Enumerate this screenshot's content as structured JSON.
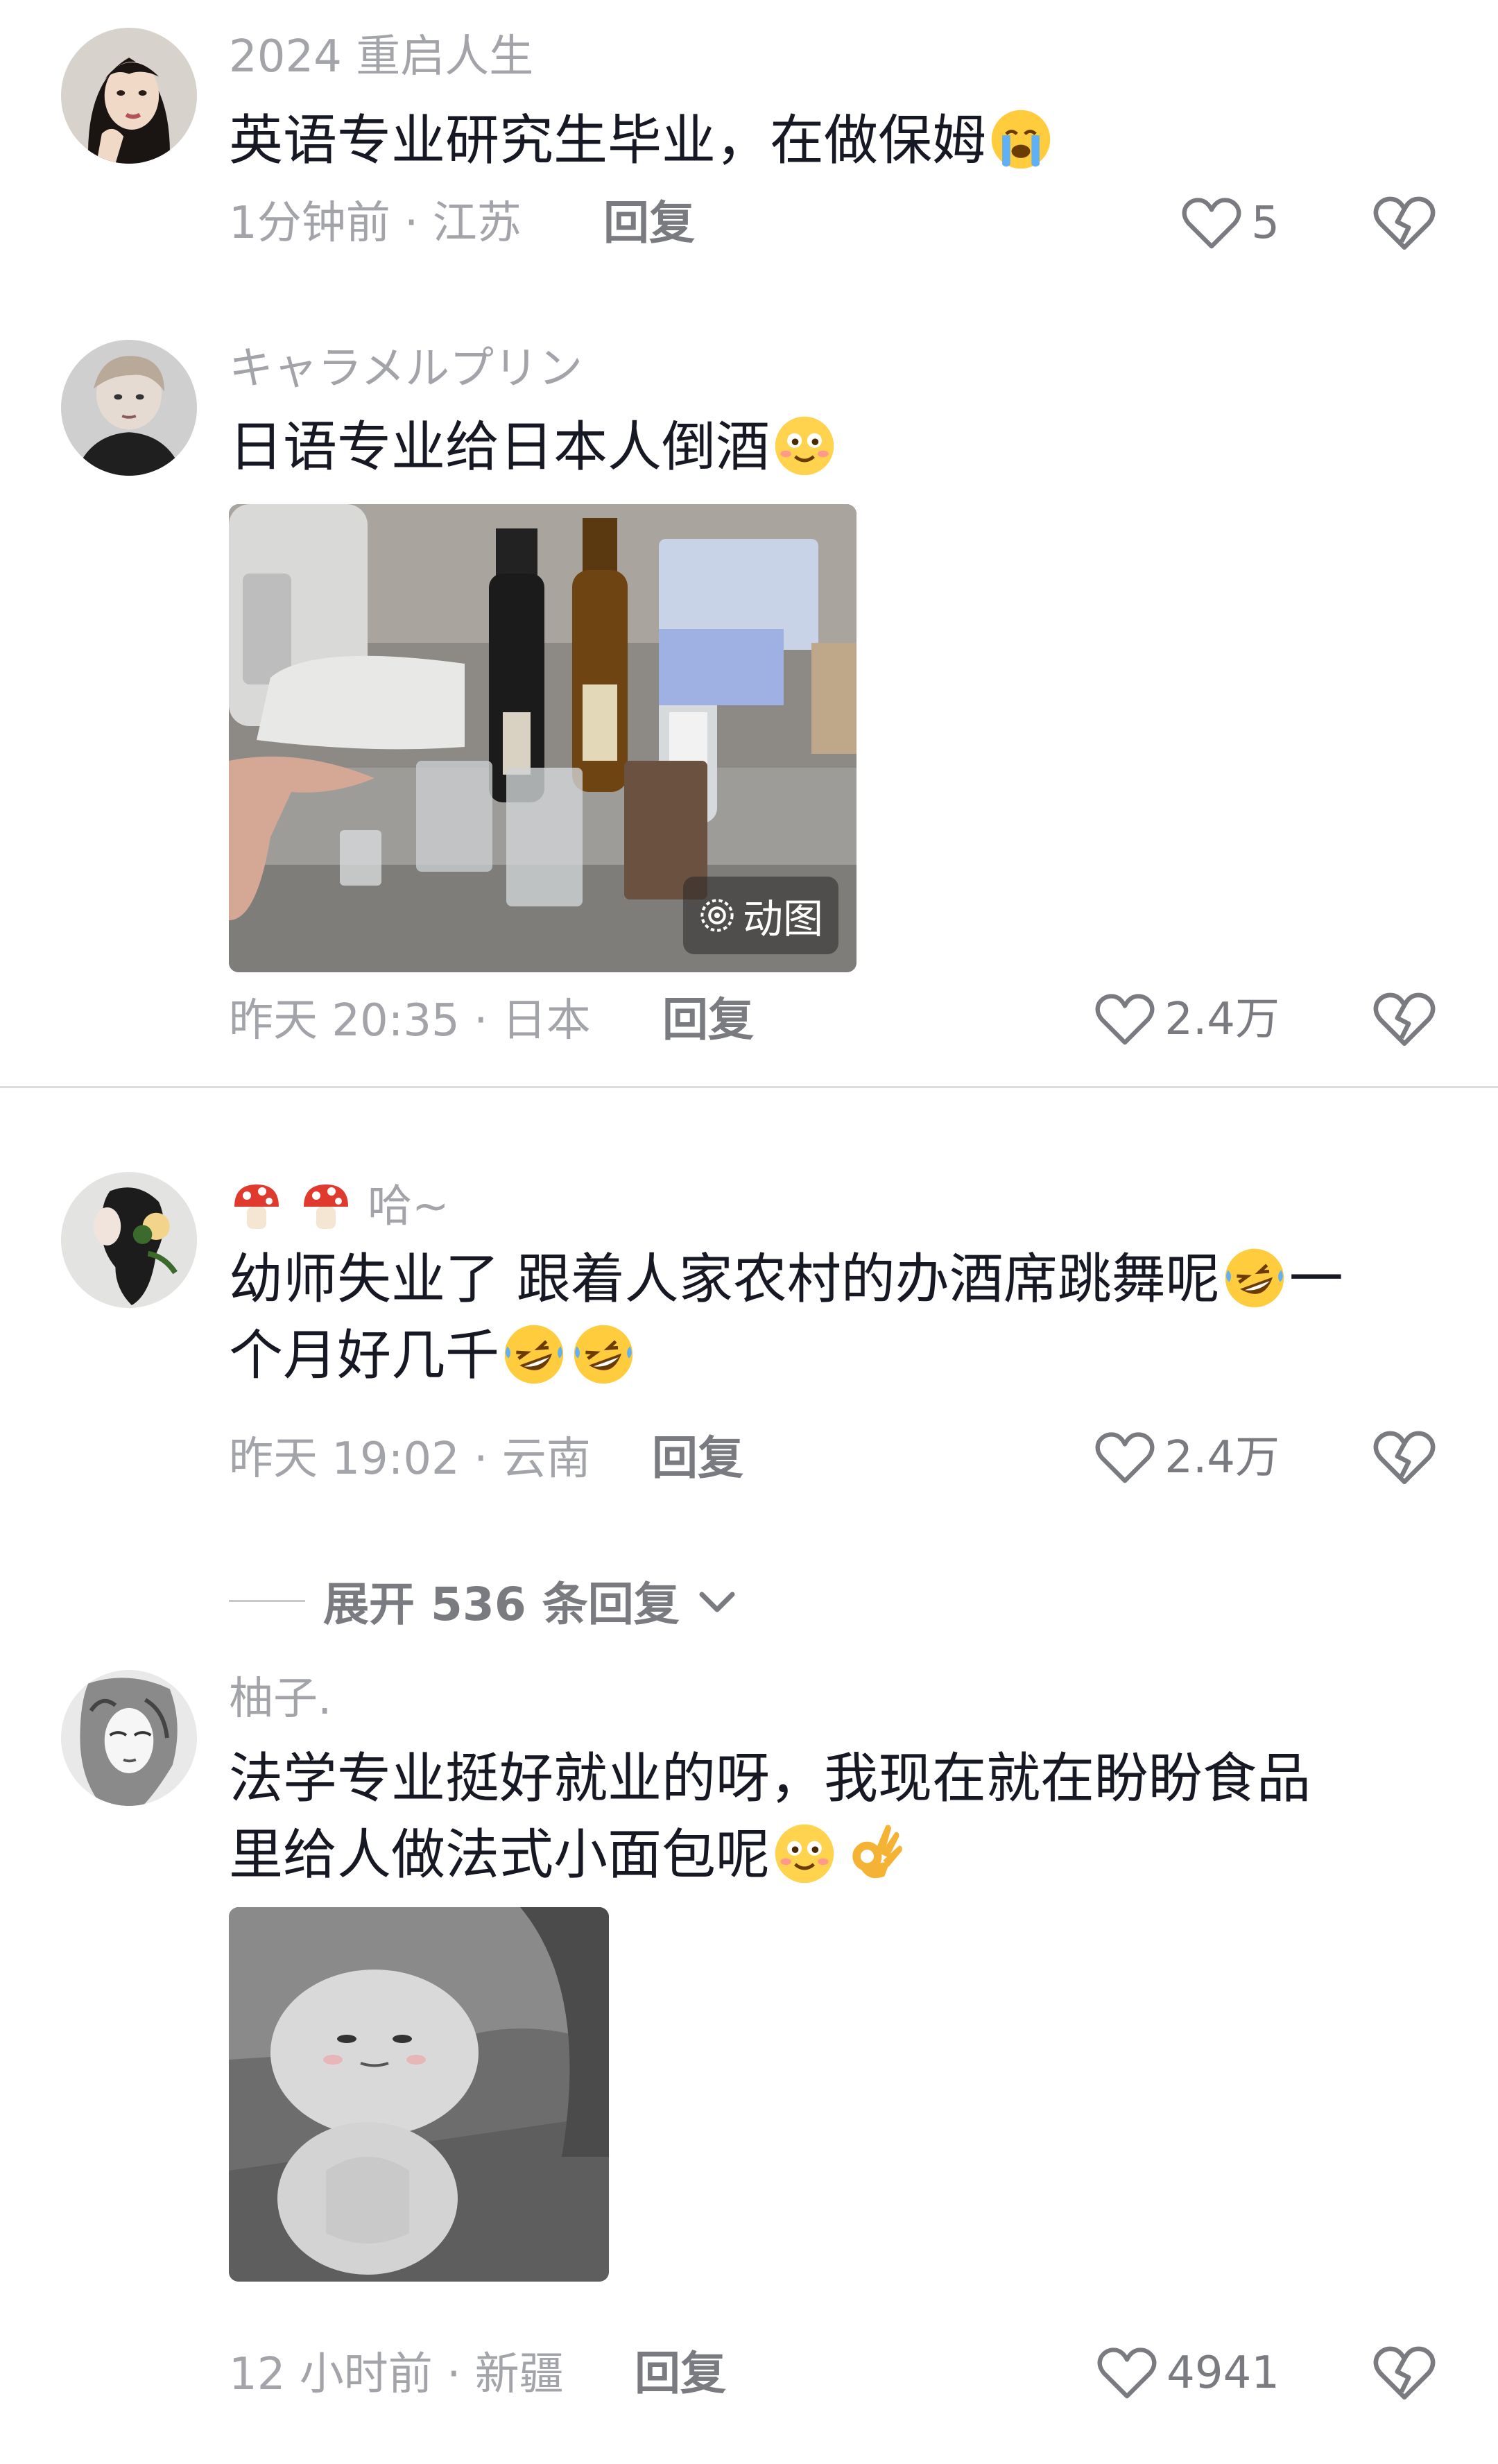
{
  "comments": [
    {
      "username": "2024 重启人生",
      "text": "英语专业研究生毕业，在做保姆",
      "emojis": [
        "crying-face"
      ],
      "time_location": "1分钟前 · 江苏",
      "reply_label": "回复",
      "likes": "5"
    },
    {
      "username": "キャラメルプリン",
      "text": "日语专业给日本人倒酒",
      "emojis": [
        "smiling-face"
      ],
      "media_badge": "动图",
      "time_location": "昨天 20:35 · 日本",
      "reply_label": "回复",
      "likes": "2.4万"
    },
    {
      "username": "哈~",
      "username_prefix_icons": [
        "mushroom",
        "mushroom"
      ],
      "text_line1": "幼师失业了 跟着人家农村的办酒席跳舞呢",
      "text_line1_end": "一",
      "text_line2": "个月好几千",
      "emojis": [
        "rofl-face",
        "rofl-face",
        "rofl-face"
      ],
      "time_location": "昨天 19:02 · 云南",
      "reply_label": "回复",
      "likes": "2.4万",
      "expand_label": "展开 536 条回复"
    },
    {
      "username": "柚子.",
      "text_line1": "法学专业挺好就业的呀，我现在就在盼盼食品",
      "text_line2": "里给人做法式小面包呢",
      "emojis": [
        "smiling-face",
        "ok-hand"
      ],
      "time_location": "12 小时前 · 新疆",
      "reply_label": "回复",
      "likes": "4941"
    }
  ],
  "colors": {
    "meta_gray": "#a3a4a9",
    "text_dark": "#161823",
    "action_gray": "#7a7b80"
  }
}
